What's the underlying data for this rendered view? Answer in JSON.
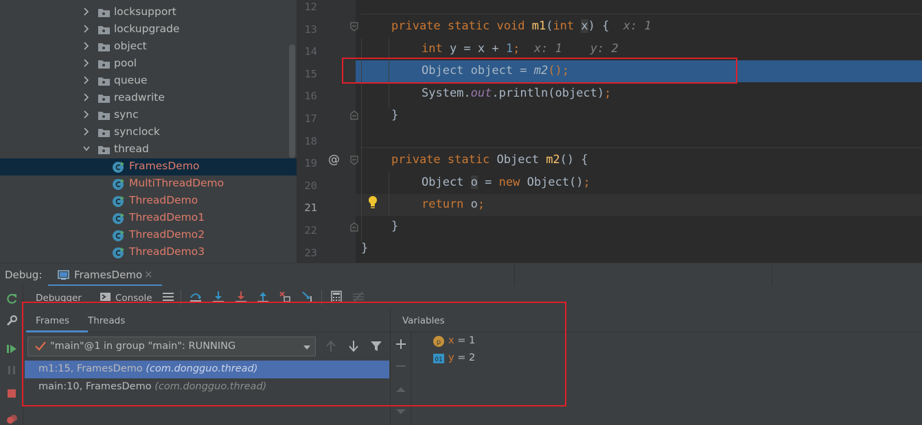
{
  "tree": {
    "items": [
      {
        "label": "locksupport",
        "kind": "folder"
      },
      {
        "label": "lockupgrade",
        "kind": "folder"
      },
      {
        "label": "object",
        "kind": "folder"
      },
      {
        "label": "pool",
        "kind": "folder"
      },
      {
        "label": "queue",
        "kind": "folder"
      },
      {
        "label": "readwrite",
        "kind": "folder"
      },
      {
        "label": "sync",
        "kind": "folder"
      },
      {
        "label": "synclock",
        "kind": "folder"
      },
      {
        "label": "thread",
        "kind": "folder",
        "expanded": true
      },
      {
        "label": "FramesDemo",
        "kind": "class",
        "selected": true
      },
      {
        "label": "MultiThreadDemo",
        "kind": "class"
      },
      {
        "label": "ThreadDemo",
        "kind": "class"
      },
      {
        "label": "ThreadDemo1",
        "kind": "class"
      },
      {
        "label": "ThreadDemo2",
        "kind": "class"
      },
      {
        "label": "ThreadDemo3",
        "kind": "class"
      }
    ]
  },
  "editor": {
    "line_numbers": [
      "12",
      "13",
      "14",
      "15",
      "16",
      "17",
      "18",
      "19",
      "20",
      "21",
      "22",
      "23"
    ],
    "current_line": "21",
    "highlighted_line": "15",
    "code": {
      "l13": {
        "kw1": "private static void ",
        "name": "m1",
        "p1": "(",
        "kw2": "int ",
        "param": "x",
        "p2": ") {",
        "hint": "x: 1"
      },
      "l14": {
        "kw": "int ",
        "body": "y = x + ",
        "num": "1",
        "semi": ";",
        "hint1": "x: 1",
        "hint2": "y: 2"
      },
      "l15": {
        "body": "Object object = ",
        "call": "m2",
        "tail": "();"
      },
      "l16": {
        "pre": "System.",
        "field": "out",
        "tail": ".println(object)",
        "semi": ";"
      },
      "l17": "}",
      "l19": {
        "kw": "private static ",
        "type": "Object ",
        "name": "m2",
        "tail": "() {"
      },
      "l20": {
        "pre": "Object ",
        "var": "o",
        "mid": " = ",
        "kw": "new ",
        "tail": "Object()",
        "semi": ";"
      },
      "l21": {
        "kw": "return ",
        "tail": "o",
        "semi": ";"
      },
      "l22": "}",
      "l23": "}"
    },
    "gutter_marker": "@"
  },
  "debug": {
    "label": "Debug:",
    "session_tab": "FramesDemo",
    "close_glyph": "×",
    "toolbar": {
      "debugger": "Debugger",
      "console": "Console"
    },
    "frames_tabs": {
      "frames": "Frames",
      "threads": "Threads"
    },
    "thread_selector": "\"main\"@1 in group \"main\": RUNNING",
    "frames": [
      {
        "method": "m1:15, FramesDemo",
        "package": "(com.dongguo.thread)",
        "selected": true
      },
      {
        "method": "main:10, FramesDemo",
        "package": "(com.dongguo.thread)",
        "selected": false
      }
    ],
    "variables_title": "Variables",
    "variables": [
      {
        "badge": "p",
        "name": "x",
        "value": " = 1"
      },
      {
        "badge": "01",
        "name": "y",
        "value": " = 2"
      }
    ]
  },
  "colors": {
    "keyword": "#cc7832",
    "method": "#ffc66d",
    "number": "#6897bb",
    "selection": "#2d5a8a",
    "annotation_box": "#e0202a",
    "frame_selected": "#4b6eaf"
  }
}
